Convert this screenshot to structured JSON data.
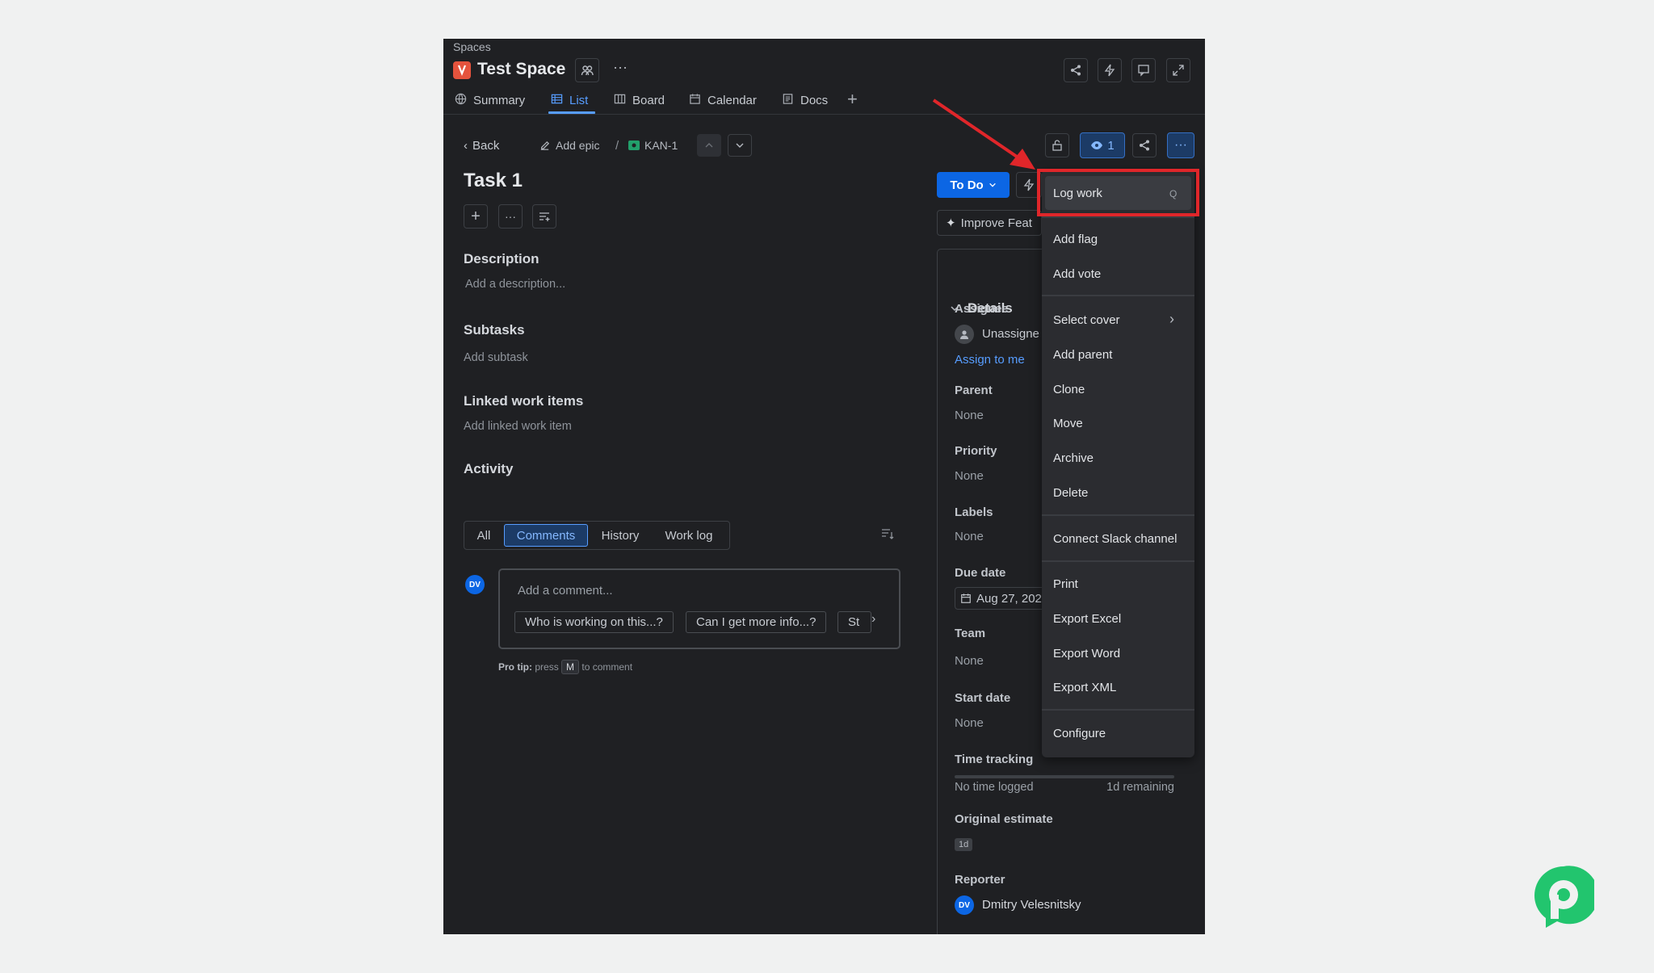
{
  "header": {
    "breadcrumb": "Spaces",
    "space_title": "Test Space",
    "more": "···"
  },
  "tabs": [
    {
      "label": "Summary",
      "icon": "globe-icon"
    },
    {
      "label": "List",
      "icon": "list-icon",
      "active": true
    },
    {
      "label": "Board",
      "icon": "board-icon"
    },
    {
      "label": "Calendar",
      "icon": "calendar-icon"
    },
    {
      "label": "Docs",
      "icon": "docs-icon"
    }
  ],
  "toolbar": {
    "back": "Back",
    "add_epic": "Add epic",
    "slash": "/",
    "issue_key": "KAN-1",
    "watch_count": "1"
  },
  "task": {
    "title": "Task 1",
    "description_title": "Description",
    "description_placeholder": "Add a description...",
    "subtasks_title": "Subtasks",
    "subtasks_add": "Add subtask",
    "linked_title": "Linked work items",
    "linked_add": "Add linked work item"
  },
  "activity": {
    "title": "Activity",
    "tabs": [
      "All",
      "Comments",
      "History",
      "Work log"
    ],
    "active_tab": "Comments",
    "avatar": "DV",
    "comment_placeholder": "Add a comment...",
    "suggestions": [
      "Who is working on this...?",
      "Can I get more info...?",
      "St"
    ],
    "protip_bold": "Pro tip:",
    "protip_press": "press",
    "protip_key": "M",
    "protip_rest": "to comment"
  },
  "status": {
    "label": "To Do",
    "improve": "Improve Feat"
  },
  "details": {
    "title": "Details",
    "assignee_label": "Assignee",
    "assignee_value": "Unassigne",
    "assign_to_me": "Assign to me",
    "parent_label": "Parent",
    "parent_value": "None",
    "priority_label": "Priority",
    "priority_value": "None",
    "labels_label": "Labels",
    "labels_value": "None",
    "due_label": "Due date",
    "due_value": "Aug 27, 202",
    "team_label": "Team",
    "team_value": "None",
    "start_label": "Start date",
    "start_value": "None",
    "time_label": "Time tracking",
    "time_logged": "No time logged",
    "time_remaining": "1d remaining",
    "estimate_label": "Original estimate",
    "estimate_value": "1d",
    "reporter_label": "Reporter",
    "reporter_avatar": "DV",
    "reporter_name": "Dmitry Velesnitsky"
  },
  "menu": {
    "log_work": "Log work",
    "log_work_shortcut": "Q",
    "add_flag": "Add flag",
    "add_vote": "Add vote",
    "select_cover": "Select cover",
    "add_parent": "Add parent",
    "clone": "Clone",
    "move": "Move",
    "archive": "Archive",
    "delete": "Delete",
    "connect_slack": "Connect Slack channel",
    "print": "Print",
    "export_excel": "Export Excel",
    "export_word": "Export Word",
    "export_xml": "Export XML",
    "configure": "Configure"
  },
  "colors": {
    "accent": "#579dff",
    "highlight": "#e0262a",
    "brand_logo": "#22c56e",
    "background": "#1f2023"
  }
}
